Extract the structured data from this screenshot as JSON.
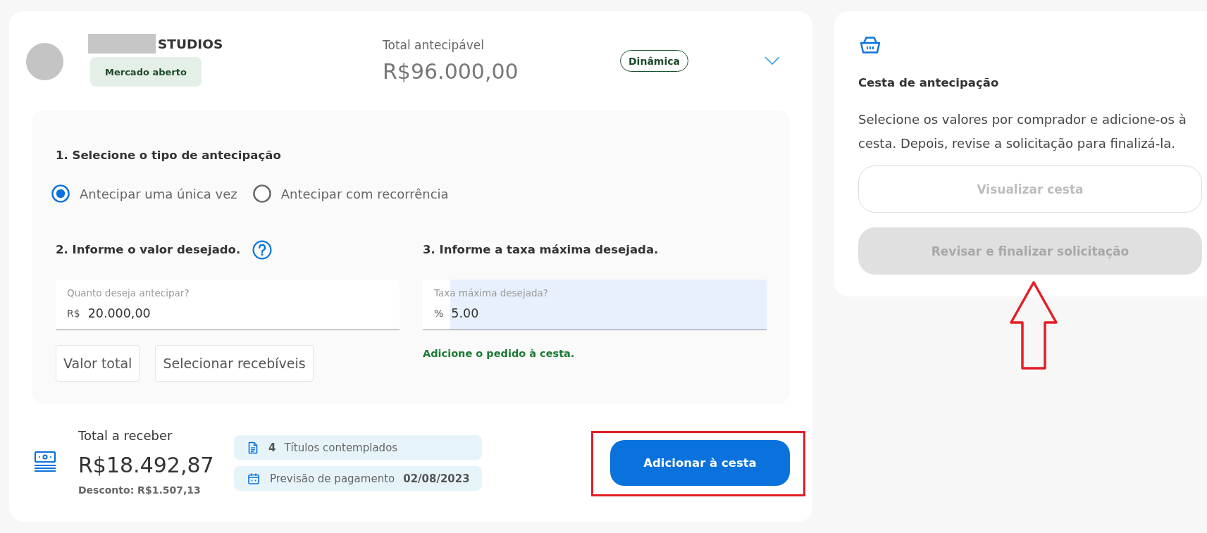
{
  "header": {
    "company_name": "STUDIOS",
    "market_badge": "Mercado aberto",
    "total_label": "Total antecipável",
    "total_amount": "R$96.000,00",
    "mode_tag": "Dinâmica"
  },
  "form": {
    "step1": {
      "title": "1. Selecione o tipo de antecipação",
      "options": [
        {
          "label": "Antecipar uma única vez",
          "selected": true
        },
        {
          "label": "Antecipar com recorrência",
          "selected": false
        }
      ]
    },
    "step2": {
      "title": "2. Informe o valor desejado.",
      "field": {
        "label": "Quanto deseja antecipar?",
        "prefix": "R$",
        "value": "20.000,00",
        "autofilled": false
      },
      "buttons": [
        "Valor total",
        "Selecionar recebíveis"
      ]
    },
    "step3": {
      "title": "3. Informe a taxa máxima desejada.",
      "field": {
        "label": "Taxa máxima desejada?",
        "prefix": "%",
        "value": "5.00",
        "autofilled": true
      },
      "hint": "Adicione o pedido à cesta."
    }
  },
  "summary": {
    "label": "Total a receber",
    "amount": "R$18.492,87",
    "discount": "Desconto: R$1.507,13",
    "chips": [
      {
        "kind": "titles",
        "value": "4",
        "label": "Títulos contemplados"
      },
      {
        "kind": "payment_date",
        "label": "Previsão de pagamento",
        "value": "02/08/2023"
      }
    ],
    "action": "Adicionar à cesta"
  },
  "basket": {
    "title": "Cesta de antecipação",
    "description": "Selecione os valores por comprador e adicione-os à cesta. Depois, revise a solicitação para finalizá-la.",
    "buttons": [
      {
        "kind": "outline",
        "label": "Visualizar cesta",
        "disabled": true
      },
      {
        "kind": "filled",
        "label": "Revisar e finalizar solicitação",
        "disabled": true
      }
    ]
  }
}
